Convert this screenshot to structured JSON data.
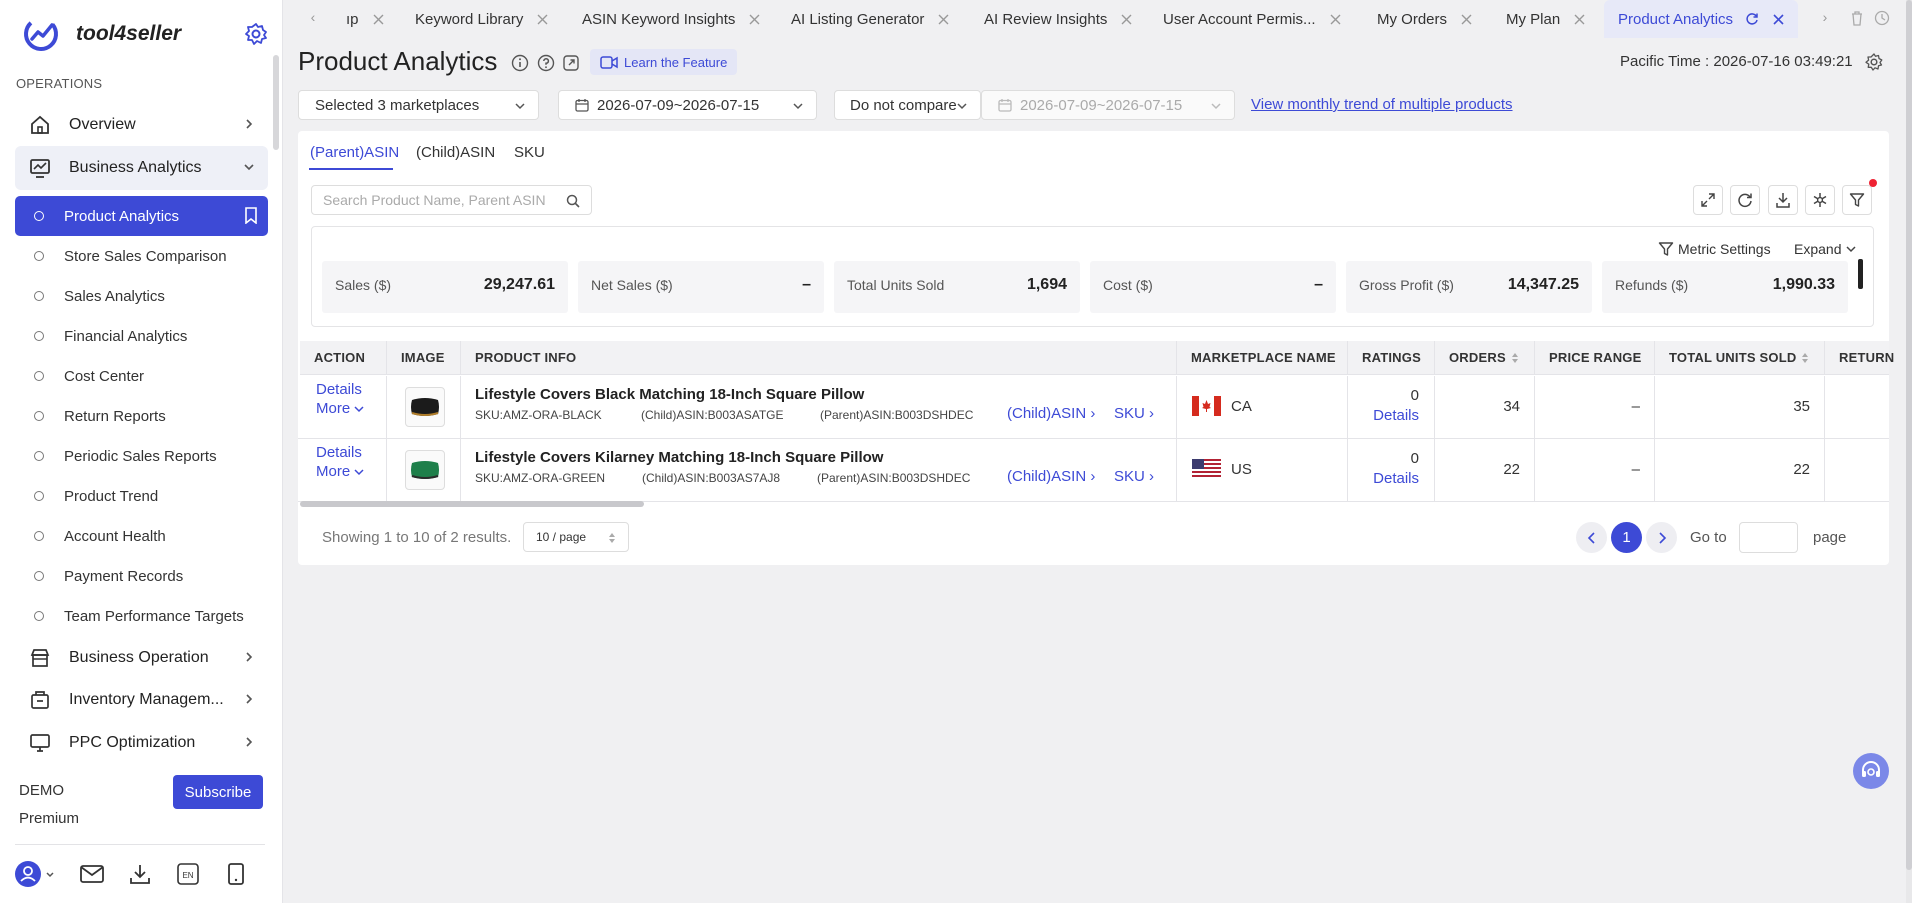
{
  "app": {
    "name": "tool4seller"
  },
  "sidebar": {
    "section_title": "OPERATIONS",
    "menu": [
      {
        "label": "Overview"
      },
      {
        "label": "Business Analytics"
      },
      {
        "label": "Business Operation"
      },
      {
        "label": "Inventory Managem..."
      },
      {
        "label": "PPC Optimization"
      }
    ],
    "submenu": [
      {
        "label": "Product Analytics"
      },
      {
        "label": "Store Sales Comparison"
      },
      {
        "label": "Sales Analytics"
      },
      {
        "label": "Financial Analytics"
      },
      {
        "label": "Cost Center"
      },
      {
        "label": "Return Reports"
      },
      {
        "label": "Periodic Sales Reports"
      },
      {
        "label": "Product Trend"
      },
      {
        "label": "Account Health"
      },
      {
        "label": "Payment Records"
      },
      {
        "label": "Team Performance Targets"
      }
    ],
    "plan_user": "DEMO",
    "plan_tier": "Premium",
    "subscribe_label": "Subscribe"
  },
  "tabs": [
    {
      "label": "ıp"
    },
    {
      "label": "Keyword Library"
    },
    {
      "label": "ASIN Keyword Insights"
    },
    {
      "label": "AI Listing Generator"
    },
    {
      "label": "AI Review Insights"
    },
    {
      "label": "User Account Permis..."
    },
    {
      "label": "My Orders"
    },
    {
      "label": "My Plan"
    },
    {
      "label": "Product Analytics"
    }
  ],
  "header": {
    "title": "Product Analytics",
    "learn_label": "Learn the Feature",
    "pacific_label": "Pacific Time :",
    "pacific_time": "2026-07-16 03:49:21"
  },
  "filters": {
    "marketplaces": "Selected 3 marketplaces",
    "date_range": "2026-07-09~2026-07-15",
    "compare": "Do not compare",
    "compare_range": "2026-07-09~2026-07-15",
    "trend_link": "View monthly trend of multiple products"
  },
  "subtabs": [
    {
      "label": "(Parent)ASIN"
    },
    {
      "label": "(Child)ASIN"
    },
    {
      "label": "SKU"
    }
  ],
  "search": {
    "placeholder": "Search Product Name, Parent ASIN"
  },
  "metrics_bar": {
    "settings_label": "Metric Settings",
    "expand_label": "Expand",
    "items": [
      {
        "label": "Sales ($)",
        "value": "29,247.61"
      },
      {
        "label": "Net Sales ($)",
        "value": "–"
      },
      {
        "label": "Total Units Sold",
        "value": "1,694"
      },
      {
        "label": "Cost ($)",
        "value": "–"
      },
      {
        "label": "Gross Profit ($)",
        "value": "14,347.25"
      },
      {
        "label": "Refunds ($)",
        "value": "1,990.33"
      }
    ]
  },
  "table": {
    "columns": [
      "ACTION",
      "IMAGE",
      "PRODUCT INFO",
      "MARKETPLACE NAME",
      "RATINGS",
      "ORDERS",
      "PRICE RANGE",
      "TOTAL UNITS SOLD",
      "RETURN"
    ],
    "details_label": "Details",
    "more_label": "More",
    "child_link": "(Child)ASIN",
    "sku_link": "SKU",
    "rows": [
      {
        "title": "Lifestyle Covers Black Matching 18-Inch Square Pillow",
        "sku": "SKU:AMZ-ORA-BLACK",
        "child_asin": "(Child)ASIN:B003ASATGE",
        "parent_asin": "(Parent)ASIN:B003DSHDEC",
        "marketplace": "CA",
        "ratings": "0",
        "orders": "34",
        "price_range": "–",
        "units": "35",
        "pillow_color": "#1b1b1b"
      },
      {
        "title": "Lifestyle Covers Kilarney Matching 18-Inch Square Pillow",
        "sku": "SKU:AMZ-ORA-GREEN",
        "child_asin": "(Child)ASIN:B003AS7AJ8",
        "parent_asin": "(Parent)ASIN:B003DSHDEC",
        "marketplace": "US",
        "ratings": "0",
        "orders": "22",
        "price_range": "–",
        "units": "22",
        "pillow_color": "#1e7f4a"
      }
    ]
  },
  "pagination": {
    "showing": "Showing 1 to 10 of 2 results.",
    "page_size": "10 / page",
    "current_page": "1",
    "goto_label": "Go to",
    "page_label": "page"
  },
  "colors": {
    "accent": "#3d4ad6",
    "active_tab_bg": "#e7e9f8"
  }
}
